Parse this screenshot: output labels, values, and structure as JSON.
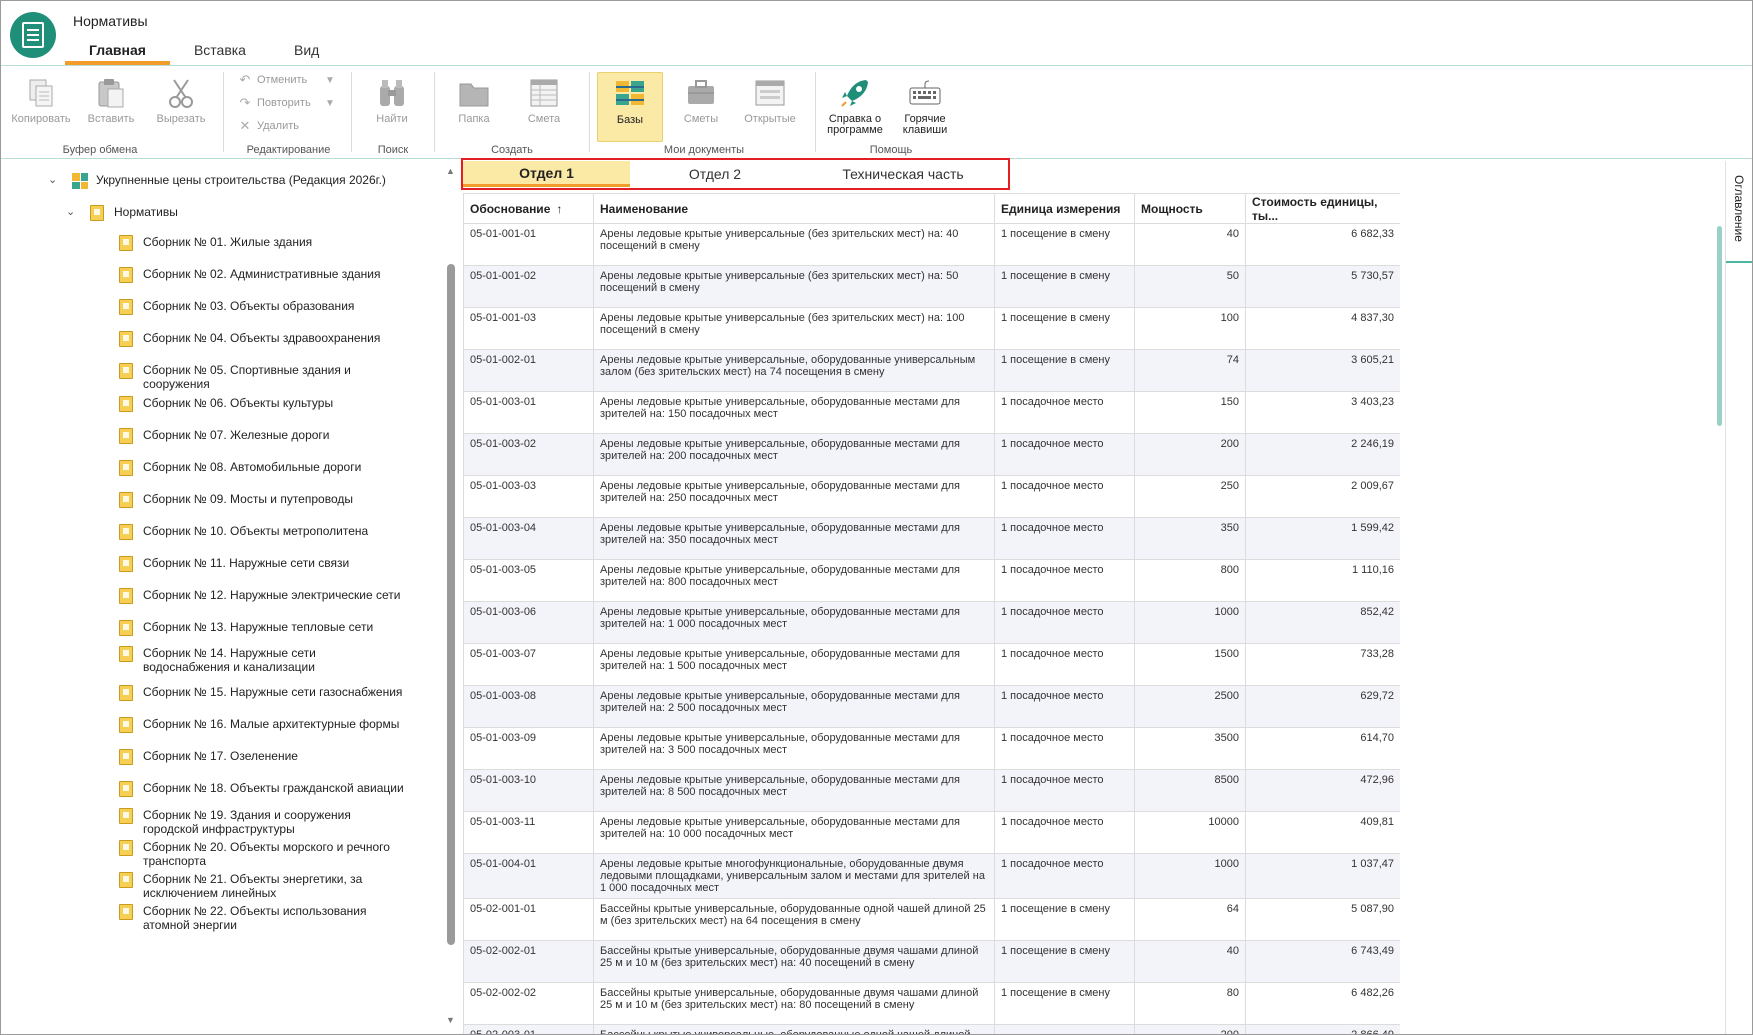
{
  "app": {
    "title": "Нормативы"
  },
  "ribbon_tabs": [
    "Главная",
    "Вставка",
    "Вид"
  ],
  "ribbon": {
    "clipboard": {
      "label": "Буфер обмена",
      "copy": "Копировать",
      "paste": "Вставить",
      "cut": "Вырезать"
    },
    "editing": {
      "label": "Редактирование",
      "undo": "Отменить",
      "redo": "Повторить",
      "delete": "Удалить"
    },
    "search": {
      "label": "Поиск",
      "find": "Найти"
    },
    "create": {
      "label": "Создать",
      "folder": "Папка",
      "estimate": "Смета"
    },
    "my_docs": {
      "label": "Мои документы",
      "bases": "Базы",
      "estimates": "Сметы",
      "opened": "Открытые"
    },
    "help": {
      "label": "Помощь",
      "about": "Справка о программе",
      "hotkeys": "Горячие клавиши"
    }
  },
  "tree": {
    "root": "Укрупненные цены строительства (Редакция 2026г.)",
    "child": "Нормативы",
    "items": [
      "Сборник № 01. Жилые здания",
      "Сборник № 02. Административные здания",
      "Сборник № 03. Объекты образования",
      "Сборник № 04. Объекты здравоохранения",
      "Сборник № 05. Спортивные здания и сооружения",
      "Сборник № 06. Объекты культуры",
      "Сборник № 07. Железные дороги",
      "Сборник № 08. Автомобильные дороги",
      "Сборник № 09. Мосты и путепроводы",
      "Сборник № 10. Объекты метрополитена",
      "Сборник № 11. Наружные сети связи",
      "Сборник № 12. Наружные электрические сети",
      "Сборник № 13. Наружные тепловые сети",
      "Сборник № 14. Наружные сети водоснабжения и канализации",
      "Сборник № 15. Наружные сети газоснабжения",
      "Сборник № 16. Малые архитектурные формы",
      "Сборник № 17. Озеленение",
      "Сборник № 18. Объекты гражданской авиации",
      "Сборник № 19. Здания и сооружения городской инфраструктуры",
      "Сборник № 20. Объекты морского и речного транспорта",
      "Сборник № 21. Объекты энергетики, за исключением линейных",
      "Сборник № 22. Объекты использования атомной энергии"
    ]
  },
  "content_tabs": [
    "Отдел 1",
    "Отдел 2",
    "Техническая часть"
  ],
  "table": {
    "columns": [
      "Обоснование",
      "Наименование",
      "Единица измерения",
      "Мощность",
      "Стоимость единицы, ты..."
    ],
    "rows": [
      [
        "05-01-001-01",
        "Арены ледовые крытые универсальные (без зрительских мест) на: 40 посещений в смену",
        "1 посещение в смену",
        "40",
        "6 682,33"
      ],
      [
        "05-01-001-02",
        "Арены ледовые крытые универсальные (без зрительских мест) на: 50 посещений в смену",
        "1 посещение в смену",
        "50",
        "5 730,57"
      ],
      [
        "05-01-001-03",
        "Арены ледовые крытые универсальные (без зрительских мест) на: 100 посещений в смену",
        "1 посещение в смену",
        "100",
        "4 837,30"
      ],
      [
        "05-01-002-01",
        "Арены ледовые крытые универсальные, оборудованные универсальным залом (без зрительских мест) на 74 посещения в смену",
        "1 посещение в смену",
        "74",
        "3 605,21"
      ],
      [
        "05-01-003-01",
        "Арены ледовые крытые универсальные, оборудованные местами для зрителей на: 150 посадочных мест",
        "1 посадочное место",
        "150",
        "3 403,23"
      ],
      [
        "05-01-003-02",
        "Арены ледовые крытые универсальные, оборудованные местами для зрителей на: 200 посадочных мест",
        "1 посадочное место",
        "200",
        "2 246,19"
      ],
      [
        "05-01-003-03",
        "Арены ледовые крытые универсальные, оборудованные местами для зрителей на: 250 посадочных мест",
        "1 посадочное место",
        "250",
        "2 009,67"
      ],
      [
        "05-01-003-04",
        "Арены ледовые крытые универсальные, оборудованные местами для зрителей на: 350 посадочных мест",
        "1 посадочное место",
        "350",
        "1 599,42"
      ],
      [
        "05-01-003-05",
        "Арены ледовые крытые универсальные, оборудованные местами для зрителей на: 800 посадочных мест",
        "1 посадочное место",
        "800",
        "1 110,16"
      ],
      [
        "05-01-003-06",
        "Арены ледовые крытые универсальные, оборудованные местами для зрителей на: 1 000 посадочных мест",
        "1 посадочное место",
        "1000",
        "852,42"
      ],
      [
        "05-01-003-07",
        "Арены ледовые крытые универсальные, оборудованные местами для зрителей на: 1 500 посадочных мест",
        "1 посадочное место",
        "1500",
        "733,28"
      ],
      [
        "05-01-003-08",
        "Арены ледовые крытые универсальные, оборудованные местами для зрителей на: 2 500 посадочных мест",
        "1 посадочное место",
        "2500",
        "629,72"
      ],
      [
        "05-01-003-09",
        "Арены ледовые крытые универсальные, оборудованные местами для зрителей на: 3 500 посадочных мест",
        "1 посадочное место",
        "3500",
        "614,70"
      ],
      [
        "05-01-003-10",
        "Арены ледовые крытые универсальные, оборудованные местами для зрителей на: 8 500 посадочных мест",
        "1 посадочное место",
        "8500",
        "472,96"
      ],
      [
        "05-01-003-11",
        "Арены ледовые крытые универсальные, оборудованные местами для зрителей на: 10 000 посадочных мест",
        "1 посадочное место",
        "10000",
        "409,81"
      ],
      [
        "05-01-004-01",
        "Арены ледовые крытые многофункциональные, оборудованные двумя ледовыми площадками, универсальным залом и местами для зрителей на 1 000 посадочных мест",
        "1 посадочное место",
        "1000",
        "1 037,47"
      ],
      [
        "05-02-001-01",
        "Бассейны крытые универсальные, оборудованные одной чашей длиной 25 м (без зрительских мест) на 64 посещения в смену",
        "1 посещение в смену",
        "64",
        "5 087,90"
      ],
      [
        "05-02-002-01",
        "Бассейны крытые универсальные, оборудованные двумя чашами длиной 25 м и 10 м (без зрительских мест) на: 40 посещений в смену",
        "1 посещение в смену",
        "40",
        "6 743,49"
      ],
      [
        "05-02-002-02",
        "Бассейны крытые универсальные, оборудованные двумя чашами длиной 25 м и 10 м (без зрительских мест) на: 80 посещений в смену",
        "1 посещение в смену",
        "80",
        "6 482,26"
      ],
      [
        "05-02-003-01",
        "Бассейны крытые универсальные, оборудованные одной чашей длиной",
        "",
        "200",
        "2 866,49"
      ]
    ]
  },
  "right_panel": {
    "tab": "Оглавление"
  },
  "colors": {
    "accent": "#f39c2c",
    "brand": "#1f8f7a",
    "highlight": "#e31e24",
    "selected_bg": "#fbe9a6"
  }
}
